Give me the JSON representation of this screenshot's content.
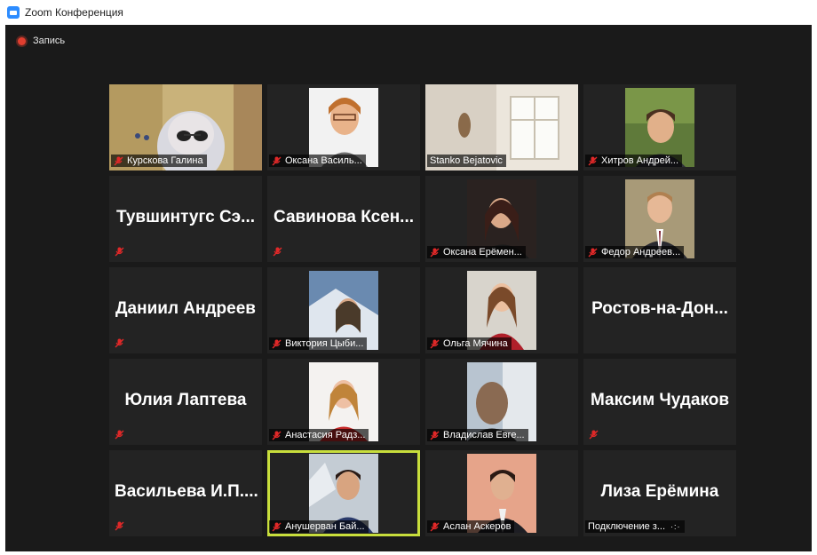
{
  "window": {
    "title": "Zoom Конференция"
  },
  "recording": {
    "label": "Запись"
  },
  "participants": [
    {
      "name": "Курскова Галина",
      "muted": true,
      "video": true
    },
    {
      "name": "Оксана Василь...",
      "muted": true,
      "video": true
    },
    {
      "name": "Stanko Bejatovic",
      "muted": false,
      "video": true
    },
    {
      "name": "Хитров Андрей...",
      "muted": true,
      "video": true
    },
    {
      "display": "Тувшинтугс Сэ...",
      "muted": true,
      "video": false
    },
    {
      "display": "Савинова Ксен...",
      "muted": true,
      "video": false
    },
    {
      "name": "Оксана Ерёмен...",
      "muted": true,
      "video": true
    },
    {
      "name": "Федор Андреев...",
      "muted": true,
      "video": true
    },
    {
      "display": "Даниил Андреев",
      "muted": true,
      "video": false
    },
    {
      "name": "Виктория Цыби...",
      "muted": true,
      "video": true
    },
    {
      "name": "Ольга Мячина",
      "muted": true,
      "video": true
    },
    {
      "display": "Ростов-на-Дон...",
      "muted": true,
      "video": false
    },
    {
      "display": "Юлия Лаптева",
      "muted": true,
      "video": false
    },
    {
      "name": "Анастасия Радз...",
      "muted": true,
      "video": true
    },
    {
      "name": "Владислав Евге...",
      "muted": true,
      "video": true
    },
    {
      "display": "Максим Чудаков",
      "muted": true,
      "video": false
    },
    {
      "display": "Васильева И.П....",
      "muted": true,
      "video": false
    },
    {
      "name": "Анушерван Бай...",
      "muted": true,
      "video": true,
      "active": true
    },
    {
      "name": "Аслан Аскеров",
      "muted": true,
      "video": true
    },
    {
      "display": "Лиза Ерёмина",
      "name": "Подключение з...",
      "muted": false,
      "video": false,
      "connecting": true
    }
  ],
  "colors": {
    "background": "#1a1a1a",
    "tile": "#232323",
    "active_outline": "#c8de3c",
    "muted_icon": "#e02828"
  }
}
